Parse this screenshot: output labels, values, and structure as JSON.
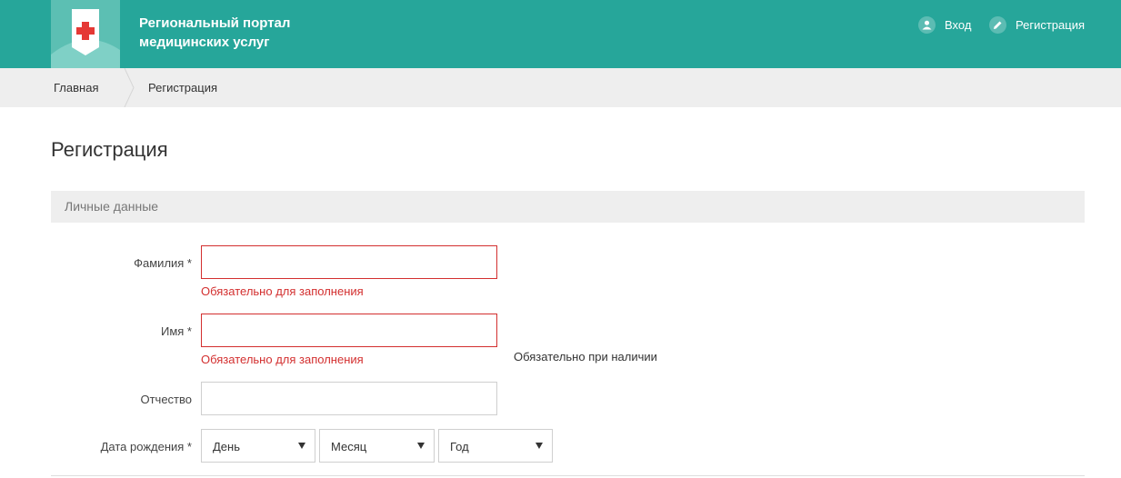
{
  "header": {
    "title_line1": "Региональный портал",
    "title_line2": "медицинских услуг",
    "login_label": "Вход",
    "register_label": "Регистрация",
    "bg_color": "#26a69a"
  },
  "breadcrumb": {
    "home": "Главная",
    "current": "Регистрация"
  },
  "page": {
    "title": "Регистрация"
  },
  "section": {
    "personal_data": "Личные данные"
  },
  "form": {
    "surname": {
      "label": "Фамилия *",
      "value": "",
      "error": "Обязательно для заполнения"
    },
    "name": {
      "label": "Имя *",
      "value": "",
      "error": "Обязательно для заполнения"
    },
    "patronymic": {
      "label": "Отчество",
      "value": "",
      "hint": "Обязательно при наличии"
    },
    "birthdate": {
      "label": "Дата рождения *",
      "day": "День",
      "month": "Месяц",
      "year": "Год"
    }
  },
  "colors": {
    "accent": "#26a69a",
    "error": "#d32f2f"
  }
}
